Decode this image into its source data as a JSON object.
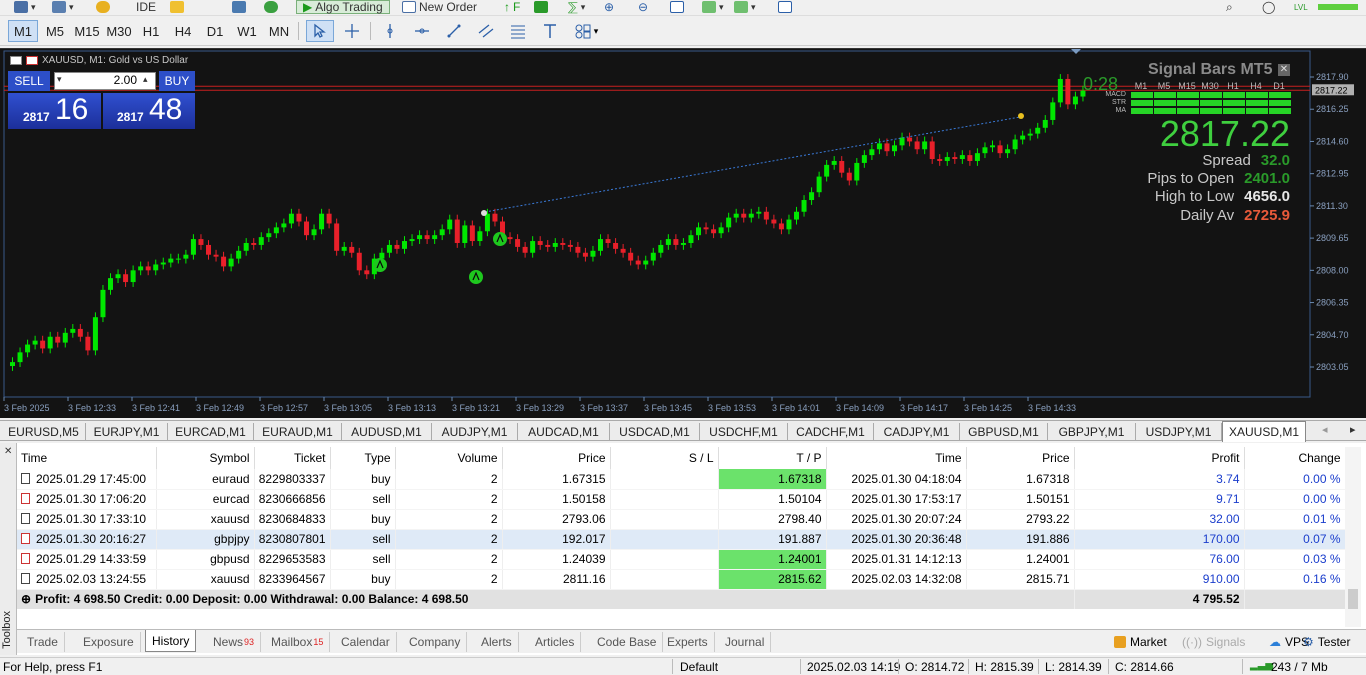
{
  "topbar": {
    "ide_label": "IDE",
    "algo_label": "Algo Trading",
    "neworder_label": "New Order",
    "lvl_label": "LVL"
  },
  "timeframes": [
    "M1",
    "M5",
    "M15",
    "M30",
    "H1",
    "H4",
    "D1",
    "W1",
    "MN"
  ],
  "active_timeframe": "M1",
  "chart": {
    "title": "XAUUSD, M1:  Gold vs US Dollar",
    "sell_label": "SELL",
    "buy_label": "BUY",
    "lot": "2.00",
    "sell_price_prefix": "2817",
    "sell_price_big": "16",
    "buy_price_prefix": "2817",
    "buy_price_big": "48",
    "countdown": "0:28",
    "y_labels": [
      "2817.90",
      "2816.25",
      "2814.60",
      "2812.95",
      "2811.30",
      "2809.65",
      "2808.00",
      "2806.35",
      "2804.70",
      "2803.05"
    ],
    "current_price_label": "2817.22",
    "x_labels": [
      "3 Feb 2025",
      "3 Feb 12:33",
      "3 Feb 12:41",
      "3 Feb 12:49",
      "3 Feb 12:57",
      "3 Feb 13:05",
      "3 Feb 13:13",
      "3 Feb 13:21",
      "3 Feb 13:29",
      "3 Feb 13:37",
      "3 Feb 13:45",
      "3 Feb 13:53",
      "3 Feb 14:01",
      "3 Feb 14:09",
      "3 Feb 14:17",
      "3 Feb 14:25",
      "3 Feb 14:33"
    ],
    "bull_color": "#00e800",
    "bear_color": "#e8202a",
    "background": "#131313"
  },
  "signal_panel": {
    "title": "Signal Bars MT5",
    "tfs": [
      "M1",
      "M5",
      "M15",
      "M30",
      "H1",
      "H4",
      "D1"
    ],
    "rows": [
      "MACD",
      "STR",
      "MA"
    ],
    "price": "2817.22",
    "spread_label": "Spread",
    "spread_value": "32.0",
    "pips_label": "Pips to Open",
    "pips_value": "2401.0",
    "hl_label": "High to Low",
    "hl_value": "4656.0",
    "daily_label": "Daily Av",
    "daily_value": "2725.9"
  },
  "symbol_tabs": [
    "EURUSD,M5",
    "EURJPY,M1",
    "EURCAD,M1",
    "EURAUD,M1",
    "AUDUSD,M1",
    "AUDJPY,M1",
    "AUDCAD,M1",
    "USDCAD,M1",
    "USDCHF,M1",
    "CADCHF,M1",
    "CADJPY,M1",
    "GBPUSD,M1",
    "GBPJPY,M1",
    "USDJPY,M1",
    "XAUUSD,M1"
  ],
  "active_symbol_tab": "XAUUSD,M1",
  "history": {
    "columns": [
      "Time",
      "Symbol",
      "Ticket",
      "Type",
      "Volume",
      "Price",
      "S / L",
      "T / P",
      "Time",
      "Price",
      "Profit",
      "Change"
    ],
    "rows": [
      {
        "time": "2025.01.29 17:45:00",
        "symbol": "euraud",
        "ticket": "8229803337",
        "type": "buy",
        "volume": "2",
        "price": "1.67315",
        "sl": "",
        "tp": "1.67318",
        "tp_hit": true,
        "ctime": "2025.01.30 04:18:04",
        "cprice": "1.67318",
        "profit": "3.74",
        "change": "0.00 %"
      },
      {
        "time": "2025.01.30 17:06:20",
        "symbol": "eurcad",
        "ticket": "8230666856",
        "type": "sell",
        "volume": "2",
        "price": "1.50158",
        "sl": "",
        "tp": "1.50104",
        "tp_hit": false,
        "ctime": "2025.01.30 17:53:17",
        "cprice": "1.50151",
        "profit": "9.71",
        "change": "0.00 %"
      },
      {
        "time": "2025.01.30 17:33:10",
        "symbol": "xauusd",
        "ticket": "8230684833",
        "type": "buy",
        "volume": "2",
        "price": "2793.06",
        "sl": "",
        "tp": "2798.40",
        "tp_hit": false,
        "ctime": "2025.01.30 20:07:24",
        "cprice": "2793.22",
        "profit": "32.00",
        "change": "0.01 %"
      },
      {
        "time": "2025.01.30 20:16:27",
        "symbol": "gbpjpy",
        "ticket": "8230807801",
        "type": "sell",
        "volume": "2",
        "price": "192.017",
        "sl": "",
        "tp": "191.887",
        "tp_hit": false,
        "ctime": "2025.01.30 20:36:48",
        "cprice": "191.886",
        "profit": "170.00",
        "change": "0.07 %"
      },
      {
        "time": "2025.01.29 14:33:59",
        "symbol": "gbpusd",
        "ticket": "8229653583",
        "type": "sell",
        "volume": "2",
        "price": "1.24039",
        "sl": "",
        "tp": "1.24001",
        "tp_hit": true,
        "ctime": "2025.01.31 14:12:13",
        "cprice": "1.24001",
        "profit": "76.00",
        "change": "0.03 %"
      },
      {
        "time": "2025.02.03 13:24:55",
        "symbol": "xauusd",
        "ticket": "8233964567",
        "type": "buy",
        "volume": "2",
        "price": "2811.16",
        "sl": "",
        "tp": "2815.62",
        "tp_hit": true,
        "ctime": "2025.02.03 14:32:08",
        "cprice": "2815.71",
        "profit": "910.00",
        "change": "0.16 %"
      }
    ],
    "summary": "Profit: 4 698.50  Credit: 0.00  Deposit: 0.00  Withdrawal: 0.00  Balance: 4 698.50",
    "summary_total": "4 795.52"
  },
  "toolbox_label": "Toolbox",
  "bottom_tabs": [
    {
      "label": "Trade",
      "badge": ""
    },
    {
      "label": "Exposure",
      "badge": ""
    },
    {
      "label": "History",
      "badge": ""
    },
    {
      "label": "News",
      "badge": "93"
    },
    {
      "label": "Mailbox",
      "badge": "15"
    },
    {
      "label": "Calendar",
      "badge": ""
    },
    {
      "label": "Company",
      "badge": ""
    },
    {
      "label": "Alerts",
      "badge": ""
    },
    {
      "label": "Articles",
      "badge": ""
    },
    {
      "label": "Code Base",
      "badge": ""
    },
    {
      "label": "Experts",
      "badge": ""
    },
    {
      "label": "Journal",
      "badge": ""
    }
  ],
  "active_bottom_tab": "History",
  "right_buttons": {
    "market": "Market",
    "signals": "Signals",
    "vps": "VPS",
    "tester": "Tester"
  },
  "status": {
    "help": "For Help, press F1",
    "profile": "Default",
    "datetime": "2025.02.03 14:19",
    "open": "O: 2814.72",
    "high": "H: 2815.39",
    "low": "L: 2814.39",
    "close": "C: 2814.66",
    "traffic": "243 / 7 Mb"
  }
}
